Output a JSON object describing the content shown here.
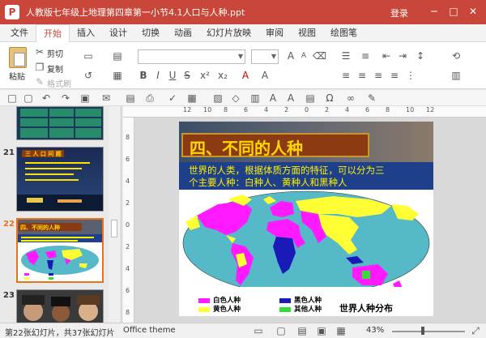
{
  "window": {
    "title": "人教版七年级上地理第四章第一小节4.1人口与人种.ppt",
    "login": "登录",
    "app_icon": "P"
  },
  "tabs": [
    {
      "label": "文件"
    },
    {
      "label": "开始"
    },
    {
      "label": "插入"
    },
    {
      "label": "设计"
    },
    {
      "label": "切换"
    },
    {
      "label": "动画"
    },
    {
      "label": "幻灯片放映"
    },
    {
      "label": "审阅"
    },
    {
      "label": "视图"
    },
    {
      "label": "绘图笔"
    }
  ],
  "ribbon": {
    "paste": "粘贴",
    "cut": "剪切",
    "copy": "复制",
    "format_painter": "格式刷"
  },
  "ruler": {
    "top": [
      "12",
      "10",
      "8",
      "6",
      "4",
      "2",
      "0",
      "2",
      "4",
      "6",
      "8",
      "10",
      "12"
    ],
    "left": [
      "8",
      "6",
      "4",
      "2",
      "0",
      "2",
      "4",
      "6",
      "8"
    ]
  },
  "slides": {
    "slide21_num": "21",
    "slide22_num": "22",
    "slide23_num": "23",
    "slide21_title": "三 人 口 问 题",
    "slide22_title": "四、不同的人种"
  },
  "current_slide": {
    "title": "四、不同的人种",
    "body_line1": "世界的人类，根据体质方面的特征，可以分为三",
    "body_line2": "个主要人种：白种人、黄种人和黑种人",
    "legend": [
      {
        "label": "白色人种",
        "color": "#ff1aff"
      },
      {
        "label": "黑色人种",
        "color": "#1a1ab8"
      },
      {
        "label": "黄色人种",
        "color": "#ffff33"
      },
      {
        "label": "其他人种",
        "color": "#33dd33"
      }
    ],
    "map_caption": "世界人种分布"
  },
  "status": {
    "slide_count": "第22张幻灯片，共37张幻灯片",
    "theme": "Office theme",
    "zoom": "43%"
  }
}
